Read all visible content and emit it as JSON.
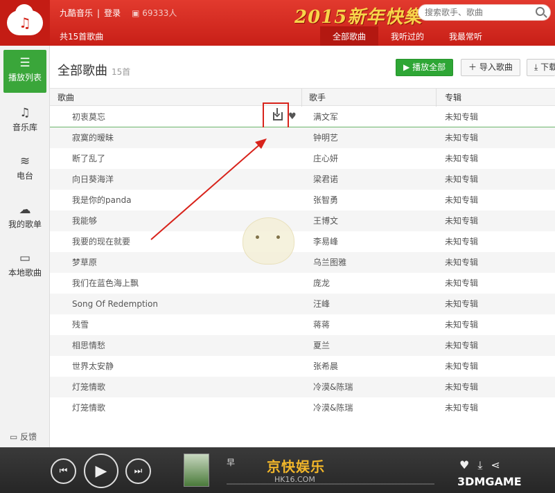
{
  "header": {
    "logo_glyph": "♫",
    "app_name": "九酷音乐",
    "login": "登录",
    "separator": "|",
    "online_count": "69333人",
    "banner": "2015新年快樂",
    "search_placeholder": "搜索歌手、歌曲",
    "total_songs": "共15首歌曲",
    "tabs": [
      {
        "label": "全部歌曲",
        "active": true
      },
      {
        "label": "我听过的",
        "active": false
      },
      {
        "label": "我最常听",
        "active": false
      }
    ]
  },
  "sidebar": {
    "items": [
      {
        "icon": "playlist-icon",
        "glyph": "☰",
        "label": "播放列表",
        "active": true
      },
      {
        "icon": "music-note-icon",
        "glyph": "♫",
        "label": "音乐库",
        "active": false
      },
      {
        "icon": "wifi-icon",
        "glyph": "≋",
        "label": "电台",
        "active": false
      },
      {
        "icon": "cloud-icon",
        "glyph": "☁",
        "label": "我的歌单",
        "active": false
      },
      {
        "icon": "monitor-icon",
        "glyph": "▭",
        "label": "本地歌曲",
        "active": false
      }
    ],
    "feedback": "反馈"
  },
  "main": {
    "title": "全部歌曲",
    "count": "15首",
    "play_all": "播放全部",
    "import": "导入歌曲",
    "download": "下载",
    "columns": {
      "song": "歌曲",
      "artist": "歌手",
      "album": "专辑"
    },
    "rows": [
      {
        "song": "初衷莫忘",
        "artist": "满文军",
        "album": "未知专辑"
      },
      {
        "song": "寂寞的暧昧",
        "artist": "钟明艺",
        "album": "未知专辑"
      },
      {
        "song": "断了乱了",
        "artist": "庄心妍",
        "album": "未知专辑"
      },
      {
        "song": "向日葵海洋",
        "artist": "梁君诺",
        "album": "未知专辑"
      },
      {
        "song": "我是你的panda",
        "artist": "张智勇",
        "album": "未知专辑"
      },
      {
        "song": "我能够",
        "artist": "王博文",
        "album": "未知专辑"
      },
      {
        "song": "我要的现在就要",
        "artist": "李易峰",
        "album": "未知专辑"
      },
      {
        "song": "梦草原",
        "artist": "乌兰图雅",
        "album": "未知专辑"
      },
      {
        "song": "我们在蓝色海上飘",
        "artist": "庞龙",
        "album": "未知专辑"
      },
      {
        "song": "Song Of Redemption",
        "artist": "汪峰",
        "album": "未知专辑"
      },
      {
        "song": "残雪",
        "artist": "蒋蒋",
        "album": "未知专辑"
      },
      {
        "song": "相思情愁",
        "artist": "夏兰",
        "album": "未知专辑"
      },
      {
        "song": "世界太安静",
        "artist": "张希晨",
        "album": "未知专辑"
      },
      {
        "song": "灯笼情歌",
        "artist": "冷漠&陈瑞",
        "album": "未知专辑"
      },
      {
        "song": "灯笼情歌",
        "artist": "冷漠&陈瑞",
        "album": "未知专辑"
      }
    ]
  },
  "player": {
    "prev_glyph": "⏮",
    "play_glyph": "▶",
    "next_glyph": "⏭",
    "now_playing": "早",
    "watermark": "京快娱乐",
    "watermark_url": "HK16.COM",
    "brand": "3DMGAME",
    "icons": [
      "heart-icon",
      "download-icon",
      "share-icon"
    ]
  },
  "annotation": {
    "color": "#d8231b"
  }
}
